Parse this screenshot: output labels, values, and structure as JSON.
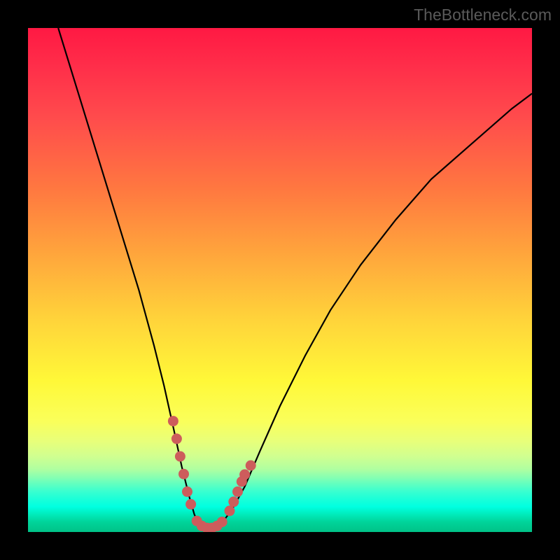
{
  "watermark": "TheBottleneck.com",
  "chart_data": {
    "type": "line",
    "title": "",
    "xlabel": "",
    "ylabel": "",
    "xlim": [
      0,
      100
    ],
    "ylim": [
      0,
      100
    ],
    "series": [
      {
        "name": "bottleneck-curve",
        "x": [
          6,
          10,
          14,
          18,
          22,
          25,
          27,
          29,
          30.5,
          32,
          33,
          34,
          35,
          36,
          37,
          38.5,
          40.5,
          43,
          46,
          50,
          55,
          60,
          66,
          73,
          80,
          88,
          96,
          100
        ],
        "y": [
          100,
          87,
          74,
          61,
          48,
          37,
          29,
          20,
          13,
          7,
          3.5,
          1.2,
          0.4,
          0.2,
          0.6,
          1.8,
          4.5,
          9,
          16,
          25,
          35,
          44,
          53,
          62,
          70,
          77,
          84,
          87
        ]
      }
    ],
    "markers": {
      "name": "highlight-dots",
      "color": "#cd5c5c",
      "points_left": [
        [
          28.8,
          22
        ],
        [
          29.5,
          18.5
        ],
        [
          30.2,
          15
        ],
        [
          30.9,
          11.5
        ],
        [
          31.6,
          8
        ],
        [
          32.3,
          5.5
        ]
      ],
      "points_floor": [
        [
          33.5,
          2.2
        ],
        [
          34.5,
          1.2
        ],
        [
          35.5,
          0.8
        ],
        [
          36.5,
          0.8
        ],
        [
          37.5,
          1.2
        ],
        [
          38.5,
          2.0
        ]
      ],
      "points_right": [
        [
          40.0,
          4.2
        ],
        [
          40.8,
          6.0
        ],
        [
          41.6,
          8.0
        ],
        [
          42.4,
          10.0
        ],
        [
          43.0,
          11.4
        ],
        [
          44.2,
          13.2
        ]
      ]
    },
    "gradient_stops": [
      {
        "pos": 0.0,
        "color": "#ff1943"
      },
      {
        "pos": 0.32,
        "color": "#ff7840"
      },
      {
        "pos": 0.58,
        "color": "#ffd43a"
      },
      {
        "pos": 0.78,
        "color": "#faff5a"
      },
      {
        "pos": 0.9,
        "color": "#60ffc0"
      },
      {
        "pos": 1.0,
        "color": "#00c287"
      }
    ]
  }
}
